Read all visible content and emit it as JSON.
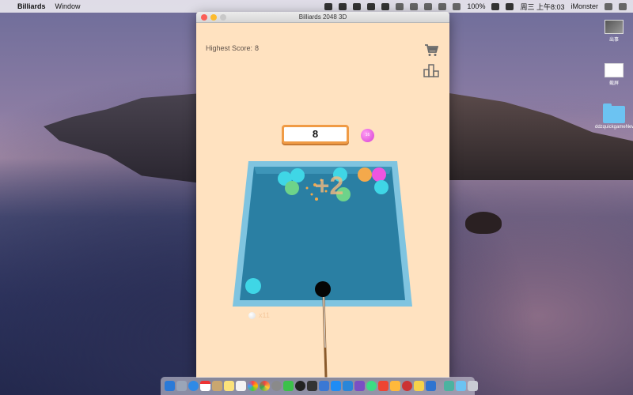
{
  "menubar": {
    "app_name": "Billiards",
    "menus": [
      "Window"
    ],
    "battery": "100%",
    "datetime": "周三 上午8:03",
    "user": "iMonster"
  },
  "desktop": {
    "icons": [
      {
        "label": "出事",
        "icon": "screenshot-thumbnail"
      },
      {
        "label": "截屏",
        "icon": "screenshot-thumbnail"
      },
      {
        "label": "ddzquickgameNew",
        "icon": "folder-icon"
      }
    ]
  },
  "window": {
    "title": "Billiards 2048 3D"
  },
  "game": {
    "highest_label": "Highest Score:",
    "highest_value": "8",
    "current_score": "8",
    "next_ball_value": "16",
    "combo_text": "+2",
    "cue_balls_left": "x11",
    "colors": {
      "background": "#ffe2c0",
      "table_felt": "#2a7fa3",
      "table_rail": "#7fc4e0",
      "score_border": "#f09b45"
    },
    "balls": [
      {
        "color": "#3fd6e6",
        "label": "2"
      },
      {
        "color": "#3fd6e6",
        "label": "2"
      },
      {
        "color": "#3fd6e6",
        "label": "2"
      },
      {
        "color": "#6ed38a",
        "label": "4"
      },
      {
        "color": "#6ed38a",
        "label": "4"
      },
      {
        "color": "#f4a94b",
        "label": "8"
      },
      {
        "color": "#ee55e0",
        "label": "16"
      },
      {
        "color": "#3fd6e6",
        "label": "2"
      },
      {
        "color": "#3fd6e6",
        "label": "2"
      }
    ]
  },
  "dock": {
    "apps": [
      "finder-icon",
      "launchpad-icon",
      "safari-icon",
      "calendar-icon",
      "contacts-icon",
      "notes-icon",
      "reminders-icon",
      "photos-icon",
      "chrome-icon",
      "system-prefs-icon",
      "wechat-icon",
      "qq-icon",
      "terminal-icon",
      "xcode-icon",
      "app-store-icon",
      "vscode-icon",
      "visual-studio-icon",
      "android-studio-icon",
      "note-app-icon",
      "app-icon",
      "app-icon",
      "app-icon",
      "app-icon"
    ]
  }
}
